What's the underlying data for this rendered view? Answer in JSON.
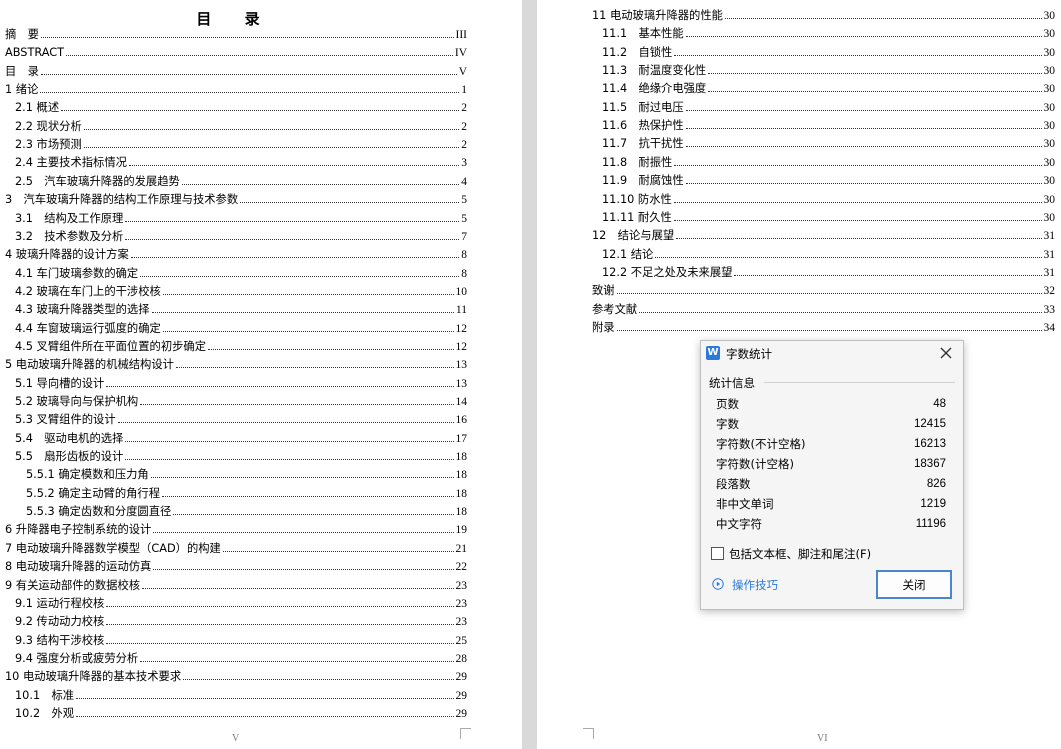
{
  "left_page": {
    "title": "目 录",
    "footer": "V",
    "entries": [
      {
        "text": "摘　要",
        "page": "III"
      },
      {
        "text": "ABSTRACT",
        "page": "IV"
      },
      {
        "text": "目　录",
        "page": "V"
      },
      {
        "text": "1 绪论",
        "page": "1"
      },
      {
        "text": "2.1 概述",
        "page": "2"
      },
      {
        "text": "2.2 现状分析",
        "page": "2"
      },
      {
        "text": "2.3 市场预测",
        "page": "2"
      },
      {
        "text": "2.4 主要技术指标情况",
        "page": "3"
      },
      {
        "text": "2.5　汽车玻璃升降器的发展趋势",
        "page": "4"
      },
      {
        "text": "3　汽车玻璃升降器的结构工作原理与技术参数",
        "page": "5"
      },
      {
        "text": "3.1　结构及工作原理",
        "page": "5"
      },
      {
        "text": "3.2　技术参数及分析",
        "page": "7"
      },
      {
        "text": "4 玻璃升降器的设计方案",
        "page": "8"
      },
      {
        "text": "4.1 车门玻璃参数的确定",
        "page": "8"
      },
      {
        "text": "4.2 玻璃在车门上的干涉校核",
        "page": "10"
      },
      {
        "text": "4.3 玻璃升降器类型的选择",
        "page": "11"
      },
      {
        "text": "4.4 车窗玻璃运行弧度的确定",
        "page": "12"
      },
      {
        "text": "4.5 叉臂组件所在平面位置的初步确定",
        "page": "12"
      },
      {
        "text": "5 电动玻璃升降器的机械结构设计",
        "page": "13"
      },
      {
        "text": "5.1 导向槽的设计",
        "page": "13"
      },
      {
        "text": "5.2 玻璃导向与保护机构",
        "page": "14"
      },
      {
        "text": "5.3 叉臂组件的设计",
        "page": "16"
      },
      {
        "text": "5.4　驱动电机的选择",
        "page": "17"
      },
      {
        "text": "5.5　扇形齿板的设计",
        "page": "18"
      },
      {
        "text": "5.5.1 确定模数和压力角",
        "page": "18"
      },
      {
        "text": "5.5.2 确定主动臂的角行程",
        "page": "18"
      },
      {
        "text": "5.5.3 确定齿数和分度圆直径",
        "page": "18"
      },
      {
        "text": "6 升降器电子控制系统的设计",
        "page": "19"
      },
      {
        "text": "7 电动玻璃升降器数学模型（CAD）的构建",
        "page": "21"
      },
      {
        "text": "8 电动玻璃升降器的运动仿真",
        "page": "22"
      },
      {
        "text": "9 有关运动部件的数据校核",
        "page": "23"
      },
      {
        "text": "9.1 运动行程校核",
        "page": "23"
      },
      {
        "text": "9.2 传动动力校核",
        "page": "23"
      },
      {
        "text": "9.3 结构干涉校核",
        "page": "25"
      },
      {
        "text": "9.4 强度分析或疲劳分析",
        "page": "28"
      },
      {
        "text": "10 电动玻璃升降器的基本技术要求",
        "page": "29"
      },
      {
        "text": "10.1　标准",
        "page": "29"
      },
      {
        "text": "10.2　外观",
        "page": "29"
      }
    ]
  },
  "right_page": {
    "footer": "VI",
    "entries": [
      {
        "text": "11 电动玻璃升降器的性能",
        "page": "30"
      },
      {
        "text": "11.1　基本性能",
        "page": "30"
      },
      {
        "text": "11.2　自锁性",
        "page": "30"
      },
      {
        "text": "11.3　耐温度变化性",
        "page": "30"
      },
      {
        "text": "11.4　绝缘介电强度",
        "page": "30"
      },
      {
        "text": "11.5　耐过电压",
        "page": "30"
      },
      {
        "text": "11.6　热保护性",
        "page": "30"
      },
      {
        "text": "11.7　抗干扰性",
        "page": "30"
      },
      {
        "text": "11.8　耐振性",
        "page": "30"
      },
      {
        "text": "11.9　耐腐蚀性",
        "page": "30"
      },
      {
        "text": "11.10 防水性",
        "page": "30"
      },
      {
        "text": "11.11 耐久性",
        "page": "30"
      },
      {
        "text": "12　结论与展望",
        "page": "31"
      },
      {
        "text": "12.1 结论",
        "page": "31"
      },
      {
        "text": "12.2 不足之处及未来展望",
        "page": "31"
      },
      {
        "text": "致谢",
        "page": "32"
      },
      {
        "text": "参考文献",
        "page": "33"
      },
      {
        "text": "附录",
        "page": "34"
      }
    ]
  },
  "dialog": {
    "app_icon": "W",
    "title": "字数统计",
    "section": "统计信息",
    "stats": [
      {
        "label": "页数",
        "value": "48"
      },
      {
        "label": "字数",
        "value": "12415"
      },
      {
        "label": "字符数(不计空格)",
        "value": "16213"
      },
      {
        "label": "字符数(计空格)",
        "value": "18367"
      },
      {
        "label": "段落数",
        "value": "826"
      },
      {
        "label": "非中文单词",
        "value": "1219"
      },
      {
        "label": "中文字符",
        "value": "11196"
      }
    ],
    "checkbox_label": "包括文本框、脚注和尾注(F)",
    "tips_label": "操作技巧",
    "close_button": "关闭",
    "accent_color": "#2b79d9"
  }
}
